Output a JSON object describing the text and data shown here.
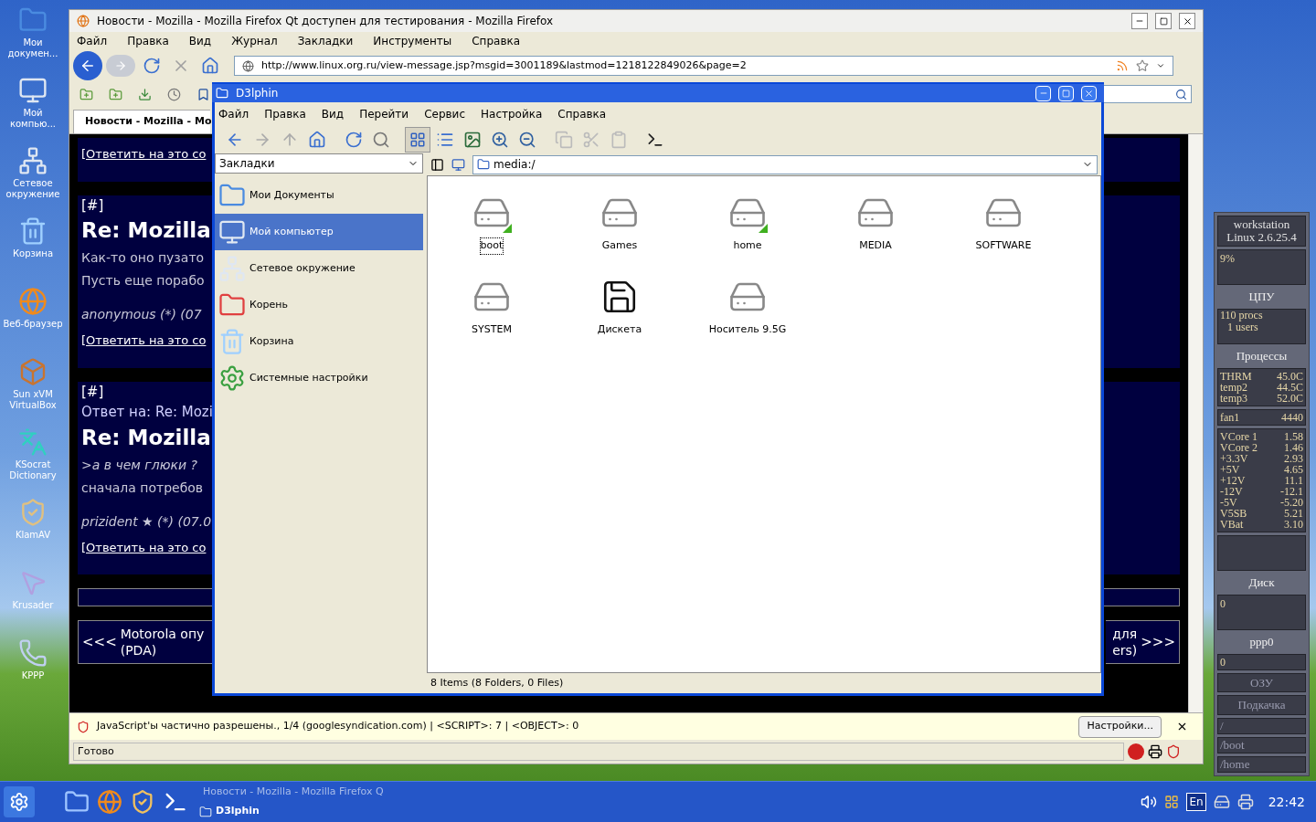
{
  "desktop_icons": [
    {
      "label": "Мои докумен...",
      "kind": "docs"
    },
    {
      "label": "Мой компью...",
      "kind": "computer"
    },
    {
      "label": "Сетевое окружение",
      "kind": "network"
    },
    {
      "label": "Корзина",
      "kind": "trash"
    },
    {
      "label": "Веб-браузер",
      "kind": "browser"
    },
    {
      "label": "Sun xVM VirtualBox",
      "kind": "vbox"
    },
    {
      "label": "KSocrat Dictionary",
      "kind": "dict"
    },
    {
      "label": "KlamAV",
      "kind": "av"
    },
    {
      "label": "Krusader",
      "kind": "krusader"
    },
    {
      "label": "KPPP",
      "kind": "kppp"
    }
  ],
  "firefox": {
    "title": "Новости - Mozilla - Mozilla Firefox Qt доступен для тестирования - Mozilla Firefox",
    "menu": [
      "Файл",
      "Правка",
      "Вид",
      "Журнал",
      "Закладки",
      "Инструменты",
      "Справка"
    ],
    "url": "http://www.linux.org.ru/view-message.jsp?msgid=3001189&lastmod=1218122849026&page=2",
    "tab": "Новости - Mozilla - Mo",
    "blocks": [
      {
        "lines": [
          {
            "kind": "link",
            "text": "[Ответить на это со"
          }
        ]
      },
      {
        "lines": [
          {
            "kind": "header",
            "text": "[#]"
          },
          {
            "kind": "title",
            "text": "Re: Mozilla"
          },
          {
            "kind": "body",
            "text": "Как-то оно пузато"
          },
          {
            "kind": "body",
            "text": "Пусть еще порабо"
          },
          {
            "kind": "signature",
            "text": "anonymous (*) (07"
          },
          {
            "kind": "link",
            "text": "[Ответить на это со"
          }
        ]
      },
      {
        "lines": [
          {
            "kind": "header",
            "text": "[#]"
          },
          {
            "kind": "reply_to",
            "text": "Ответ на: Re: Mozi"
          },
          {
            "kind": "title",
            "text": "Re: Mozilla"
          },
          {
            "kind": "quote",
            "text": ">а в чем глюки ?"
          },
          {
            "kind": "body",
            "text": "сначала потребов"
          },
          {
            "kind": "signature",
            "text": "prizident ★ (*) (07.0"
          },
          {
            "kind": "link",
            "text": "[Ответить на это со"
          }
        ]
      }
    ],
    "nav_prev": {
      "arrow": "<<<",
      "lines": [
        "Motorola опу",
        "(PDA)"
      ]
    },
    "nav_next": {
      "arrow": ">>>",
      "lines": [
        "для",
        "ers)"
      ]
    },
    "notification": "JavaScript'ы частично разрешены., 1/4 (googlesyndication.com) | <SCRIPT>: 7 | <OBJECT>: 0",
    "notification_button": "Настройки...",
    "status": "Готово"
  },
  "dolphin": {
    "title": "D3lphin",
    "menu": [
      "Файл",
      "Правка",
      "Вид",
      "Перейти",
      "Сервис",
      "Настройка",
      "Справка"
    ],
    "places_label": "Закладки",
    "places": [
      {
        "label": "Мои Документы",
        "kind": "docs",
        "selected": false
      },
      {
        "label": "Мой компьютер",
        "kind": "computer",
        "selected": true
      },
      {
        "label": "Сетевое окружение",
        "kind": "network",
        "selected": false
      },
      {
        "label": "Корень",
        "kind": "root",
        "selected": false
      },
      {
        "label": "Корзина",
        "kind": "trash",
        "selected": false
      },
      {
        "label": "Системные настройки",
        "kind": "settings",
        "selected": false
      }
    ],
    "location": "media:/",
    "items": [
      {
        "label": "boot",
        "kind": "drive",
        "mounted": true,
        "selected": true
      },
      {
        "label": "Games",
        "kind": "drive",
        "mounted": false,
        "selected": false
      },
      {
        "label": "home",
        "kind": "drive",
        "mounted": true,
        "selected": false
      },
      {
        "label": "MEDIA",
        "kind": "drive",
        "mounted": false,
        "selected": false
      },
      {
        "label": "SOFTWARE",
        "kind": "drive",
        "mounted": false,
        "selected": false
      },
      {
        "label": "SYSTEM",
        "kind": "drive",
        "mounted": false,
        "selected": false
      },
      {
        "label": "Дискета",
        "kind": "floppy",
        "mounted": false,
        "selected": false
      },
      {
        "label": "Носитель 9.5G",
        "kind": "drive",
        "mounted": false,
        "selected": false
      }
    ],
    "status": "8 Items (8 Folders, 0 Files)"
  },
  "gkrellm": {
    "host": "workstation",
    "kernel": "Linux 2.6.25.4",
    "cpu_reading": "9%",
    "cpu_label": "ЦПУ",
    "procs": "110 procs",
    "users": "1 users",
    "procs_label": "Процессы",
    "temps": [
      {
        "name": "THRM",
        "value": "45.0C"
      },
      {
        "name": "temp2",
        "value": "44.5C"
      },
      {
        "name": "temp3",
        "value": "52.0C"
      }
    ],
    "fans": [
      {
        "name": "fan1",
        "value": "4440"
      }
    ],
    "volts": [
      {
        "name": "VCore 1",
        "value": "1.58"
      },
      {
        "name": "VCore 2",
        "value": "1.46"
      },
      {
        "name": "+3.3V",
        "value": "2.93"
      },
      {
        "name": "+5V",
        "value": "4.65"
      },
      {
        "name": "+12V",
        "value": "11.1"
      },
      {
        "name": "-12V",
        "value": "-12.1"
      },
      {
        "name": "-5V",
        "value": "-5.20"
      },
      {
        "name": "V5SB",
        "value": "5.21"
      },
      {
        "name": "VBat",
        "value": "3.10"
      }
    ],
    "disk_reading": "0",
    "disk_label": "Диск",
    "net_label": "ppp0",
    "net_reading": "0",
    "mem_label": "ОЗУ",
    "swap_label": "Подкачка",
    "mounts": [
      "/",
      "/boot",
      "/home"
    ]
  },
  "taskbar": {
    "tasks": [
      {
        "label": "Новости - Mozilla - Mozilla Firefox Q",
        "kind": "browser",
        "selected": false
      },
      {
        "label": "D3lphin",
        "kind": "files",
        "selected": true
      }
    ],
    "keyboard": "En",
    "clock": "22:42"
  }
}
